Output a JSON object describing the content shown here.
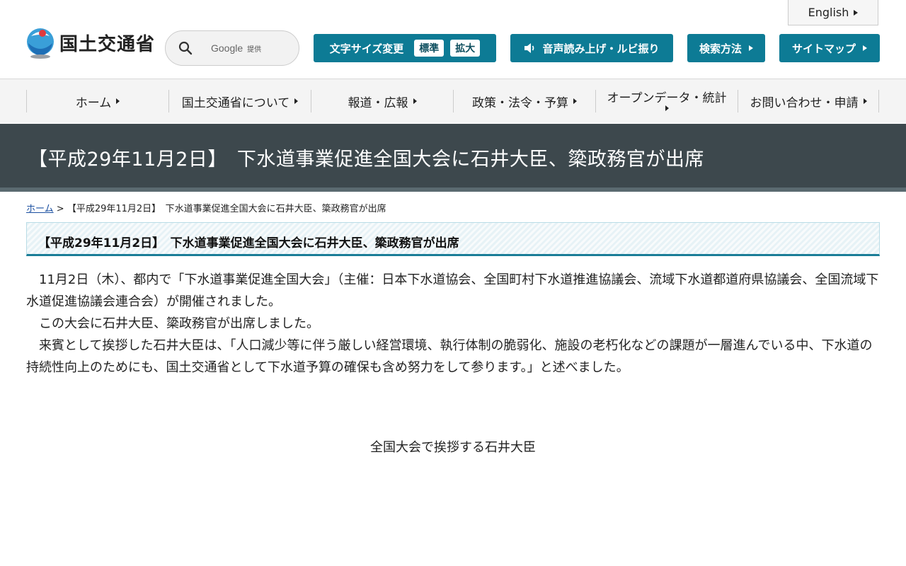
{
  "header": {
    "english_label": "English",
    "logo_text": "国土交通省",
    "search": {
      "brand": "Google",
      "provided": "提供"
    },
    "font_size": {
      "label": "文字サイズ変更",
      "standard": "標準",
      "large": "拡大"
    },
    "speech_label": "音声読み上げ・ルビ振り",
    "search_method_label": "検索方法",
    "sitemap_label": "サイトマップ"
  },
  "nav": {
    "items": [
      {
        "label": "ホーム"
      },
      {
        "label": "国土交通省について"
      },
      {
        "label": "報道・広報"
      },
      {
        "label": "政策・法令・予算"
      },
      {
        "label": "オープンデータ・統計"
      },
      {
        "label": "お問い合わせ・申請"
      }
    ]
  },
  "page": {
    "title": "【平成29年11月2日】　下水道事業促進全国大会に石井大臣、簗政務官が出席",
    "breadcrumb": {
      "home": "ホーム",
      "separator": ">",
      "current": "【平成29年11月2日】　下水道事業促進全国大会に石井大臣、簗政務官が出席"
    },
    "heading": "【平成29年11月2日】　下水道事業促進全国大会に石井大臣、簗政務官が出席",
    "paragraphs": [
      "　11月2日（木）、都内で「下水道事業促進全国大会」（主催：日本下水道協会、全国町村下水道推進協議会、流域下水道都道府県協議会、全国流域下水道促進協議会連合会）が開催されました。",
      "　この大会に石井大臣、簗政務官が出席しました。",
      "　来賓として挨拶した石井大臣は、「人口減少等に伴う厳しい経営環境、執行体制の脆弱化、施設の老朽化などの課題が一層進んでいる中、下水道の持続性向上のためにも、国土交通省として下水道予算の確保も含め努力をして参ります。」と述べました。"
    ],
    "photo_caption": "全国大会で挨拶する石井大臣"
  },
  "colors": {
    "teal_button": "#0d7b95",
    "banner_bg": "#3d484d",
    "nav_bg": "#f4f4f4"
  }
}
